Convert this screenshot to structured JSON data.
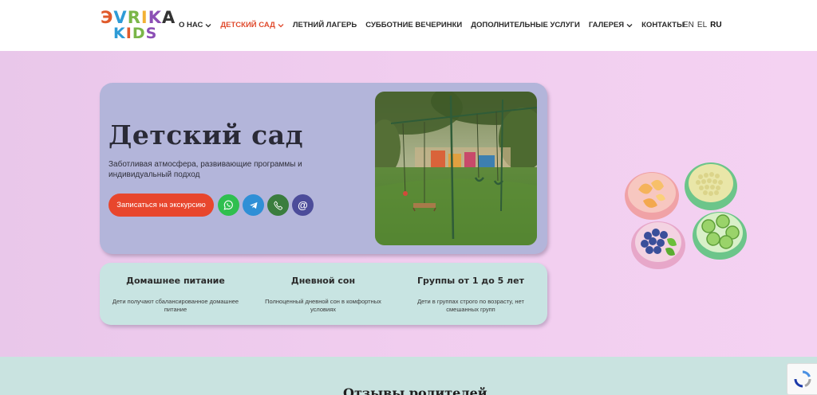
{
  "logo": {
    "line1": "ЭVRIKA",
    "line2": "KIDS"
  },
  "nav": {
    "items": [
      {
        "label": "О НАС",
        "dropdown": true,
        "active": false
      },
      {
        "label": "ДЕТСКИЙ САД",
        "dropdown": true,
        "active": true
      },
      {
        "label": "ЛЕТНИЙ ЛАГЕРЬ",
        "dropdown": false,
        "active": false
      },
      {
        "label": "СУББОТНИЕ ВЕЧЕРИНКИ",
        "dropdown": false,
        "active": false
      },
      {
        "label": "ДОПОЛНИТЕЛЬНЫЕ УСЛУГИ",
        "dropdown": false,
        "active": false
      },
      {
        "label": "ГАЛЕРЕЯ",
        "dropdown": true,
        "active": false
      },
      {
        "label": "КОНТАКТЫ",
        "dropdown": false,
        "active": false
      }
    ],
    "languages": [
      "EN",
      "EL",
      "RU"
    ],
    "active_language": "RU"
  },
  "hero": {
    "title": "Детский сад",
    "subtitle": "Заботливая атмосфера, развивающие программы и индивидуальный подход",
    "cta_label": "Записаться на экскурсию",
    "contact_icons": [
      "whatsapp-icon",
      "telegram-icon",
      "phone-icon",
      "email-icon"
    ],
    "contact_colors": [
      "#2fbf4f",
      "#2f8fd6",
      "#3a7d3e",
      "#4c4c9a"
    ]
  },
  "features": [
    {
      "title": "Домашнее питание",
      "text": "Дети получают сбалансированное домашнее питание"
    },
    {
      "title": "Дневной сон",
      "text": "Полноценный дневной сон в комфортных условиях"
    },
    {
      "title": "Группы от 1 до 5 лет",
      "text": "Дети в группах строго по возрасту, нет смешанных групп"
    }
  ],
  "next_section": {
    "title": "Отзывы родителей"
  },
  "colors": {
    "accent": "#e8462d",
    "hero_bg": "#f1cdef",
    "card_main": "#b3b5da",
    "card_features": "#c8e4e2"
  }
}
